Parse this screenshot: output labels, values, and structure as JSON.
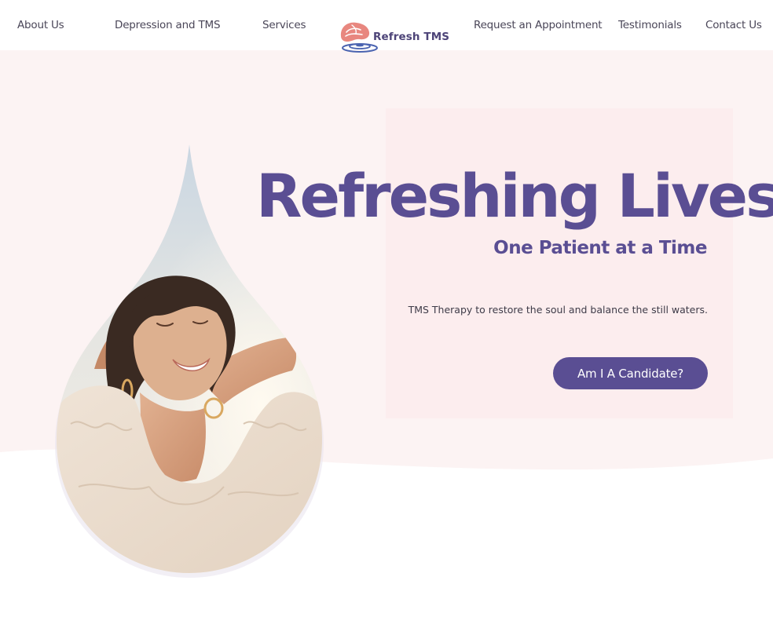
{
  "nav": {
    "about": "About Us",
    "depression": "Depression and TMS",
    "services": "Services",
    "appointment": "Request an Appointment",
    "testimonials": "Testimonials",
    "contact": "Contact Us"
  },
  "logo": {
    "text": "Refresh TMS",
    "icon": "brain-ripple-icon"
  },
  "hero": {
    "title": "Refreshing Lives",
    "subtitle": "One Patient at a Time",
    "tagline": "TMS Therapy to restore the soul and balance the still waters.",
    "cta_label": "Am I A Candidate?",
    "image": "woman-smiling-sunlight-photo"
  },
  "colors": {
    "brand_purple": "#5a4e93",
    "hero_background": "#fcf3f3",
    "panel_pink": "#fbebec",
    "logo_coral": "#e8877f",
    "logo_blue": "#4a63b0"
  }
}
